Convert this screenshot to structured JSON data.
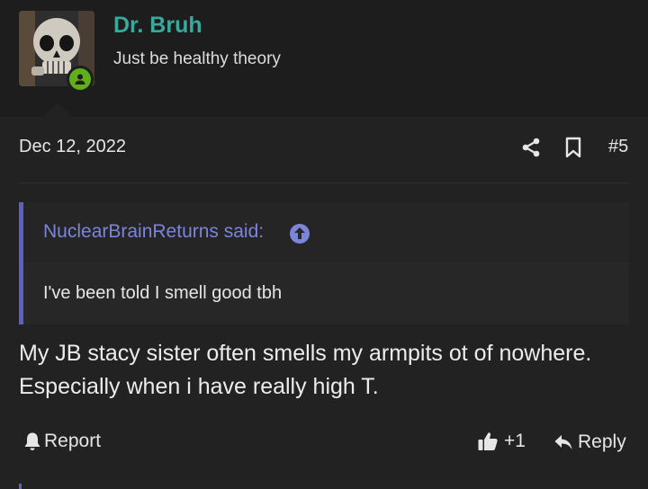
{
  "user": {
    "name": "Dr. Bruh",
    "title": "Just be healthy theory"
  },
  "post": {
    "date": "Dec 12, 2022",
    "number": "#5",
    "quote": {
      "author": "NuclearBrainReturns said:",
      "text": "I've been told I smell good tbh"
    },
    "message": "My JB stacy sister often smells my armpits ot of nowhere. Especially when i have really high T.",
    "actions": {
      "report": "Report",
      "like_count": "+1",
      "reply": "Reply"
    }
  },
  "colors": {
    "accent_username": "#3aa89b",
    "quote_accent": "#5a63c2",
    "online_status": "#5fae1a"
  },
  "icons": [
    "share-icon",
    "bookmark-icon",
    "arrow-up-circle-icon",
    "bell-icon",
    "thumbs-up-icon",
    "reply-icon",
    "user-icon"
  ]
}
